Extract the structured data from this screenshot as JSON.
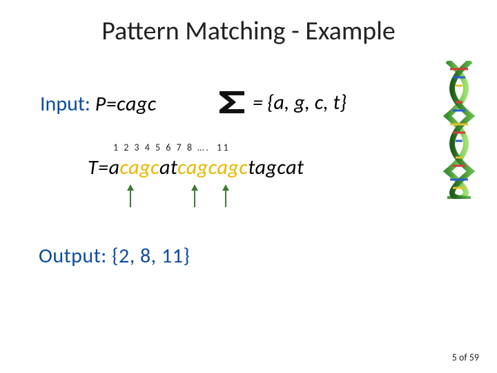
{
  "title": "Pattern Matching - Example",
  "input": {
    "label": "Input:  ",
    "pattern_prefix": "P=",
    "pattern": "cagc"
  },
  "alphabet": {
    "equals": "= ",
    "set": "{a, g, c, t}"
  },
  "indices": {
    "first": "1 2 3 4 5 6 7 8 …. ",
    "eleven": "11"
  },
  "sequence": {
    "prefix": "T=",
    "s1": "a",
    "h1": "cagc",
    "s2": "at",
    "h2": "cagcagc",
    "s3": "tagcat"
  },
  "output": {
    "label": "Output: ",
    "value": "{2, 8, 11}"
  },
  "footer": {
    "page": "5",
    "of": " of ",
    "total": "59"
  }
}
